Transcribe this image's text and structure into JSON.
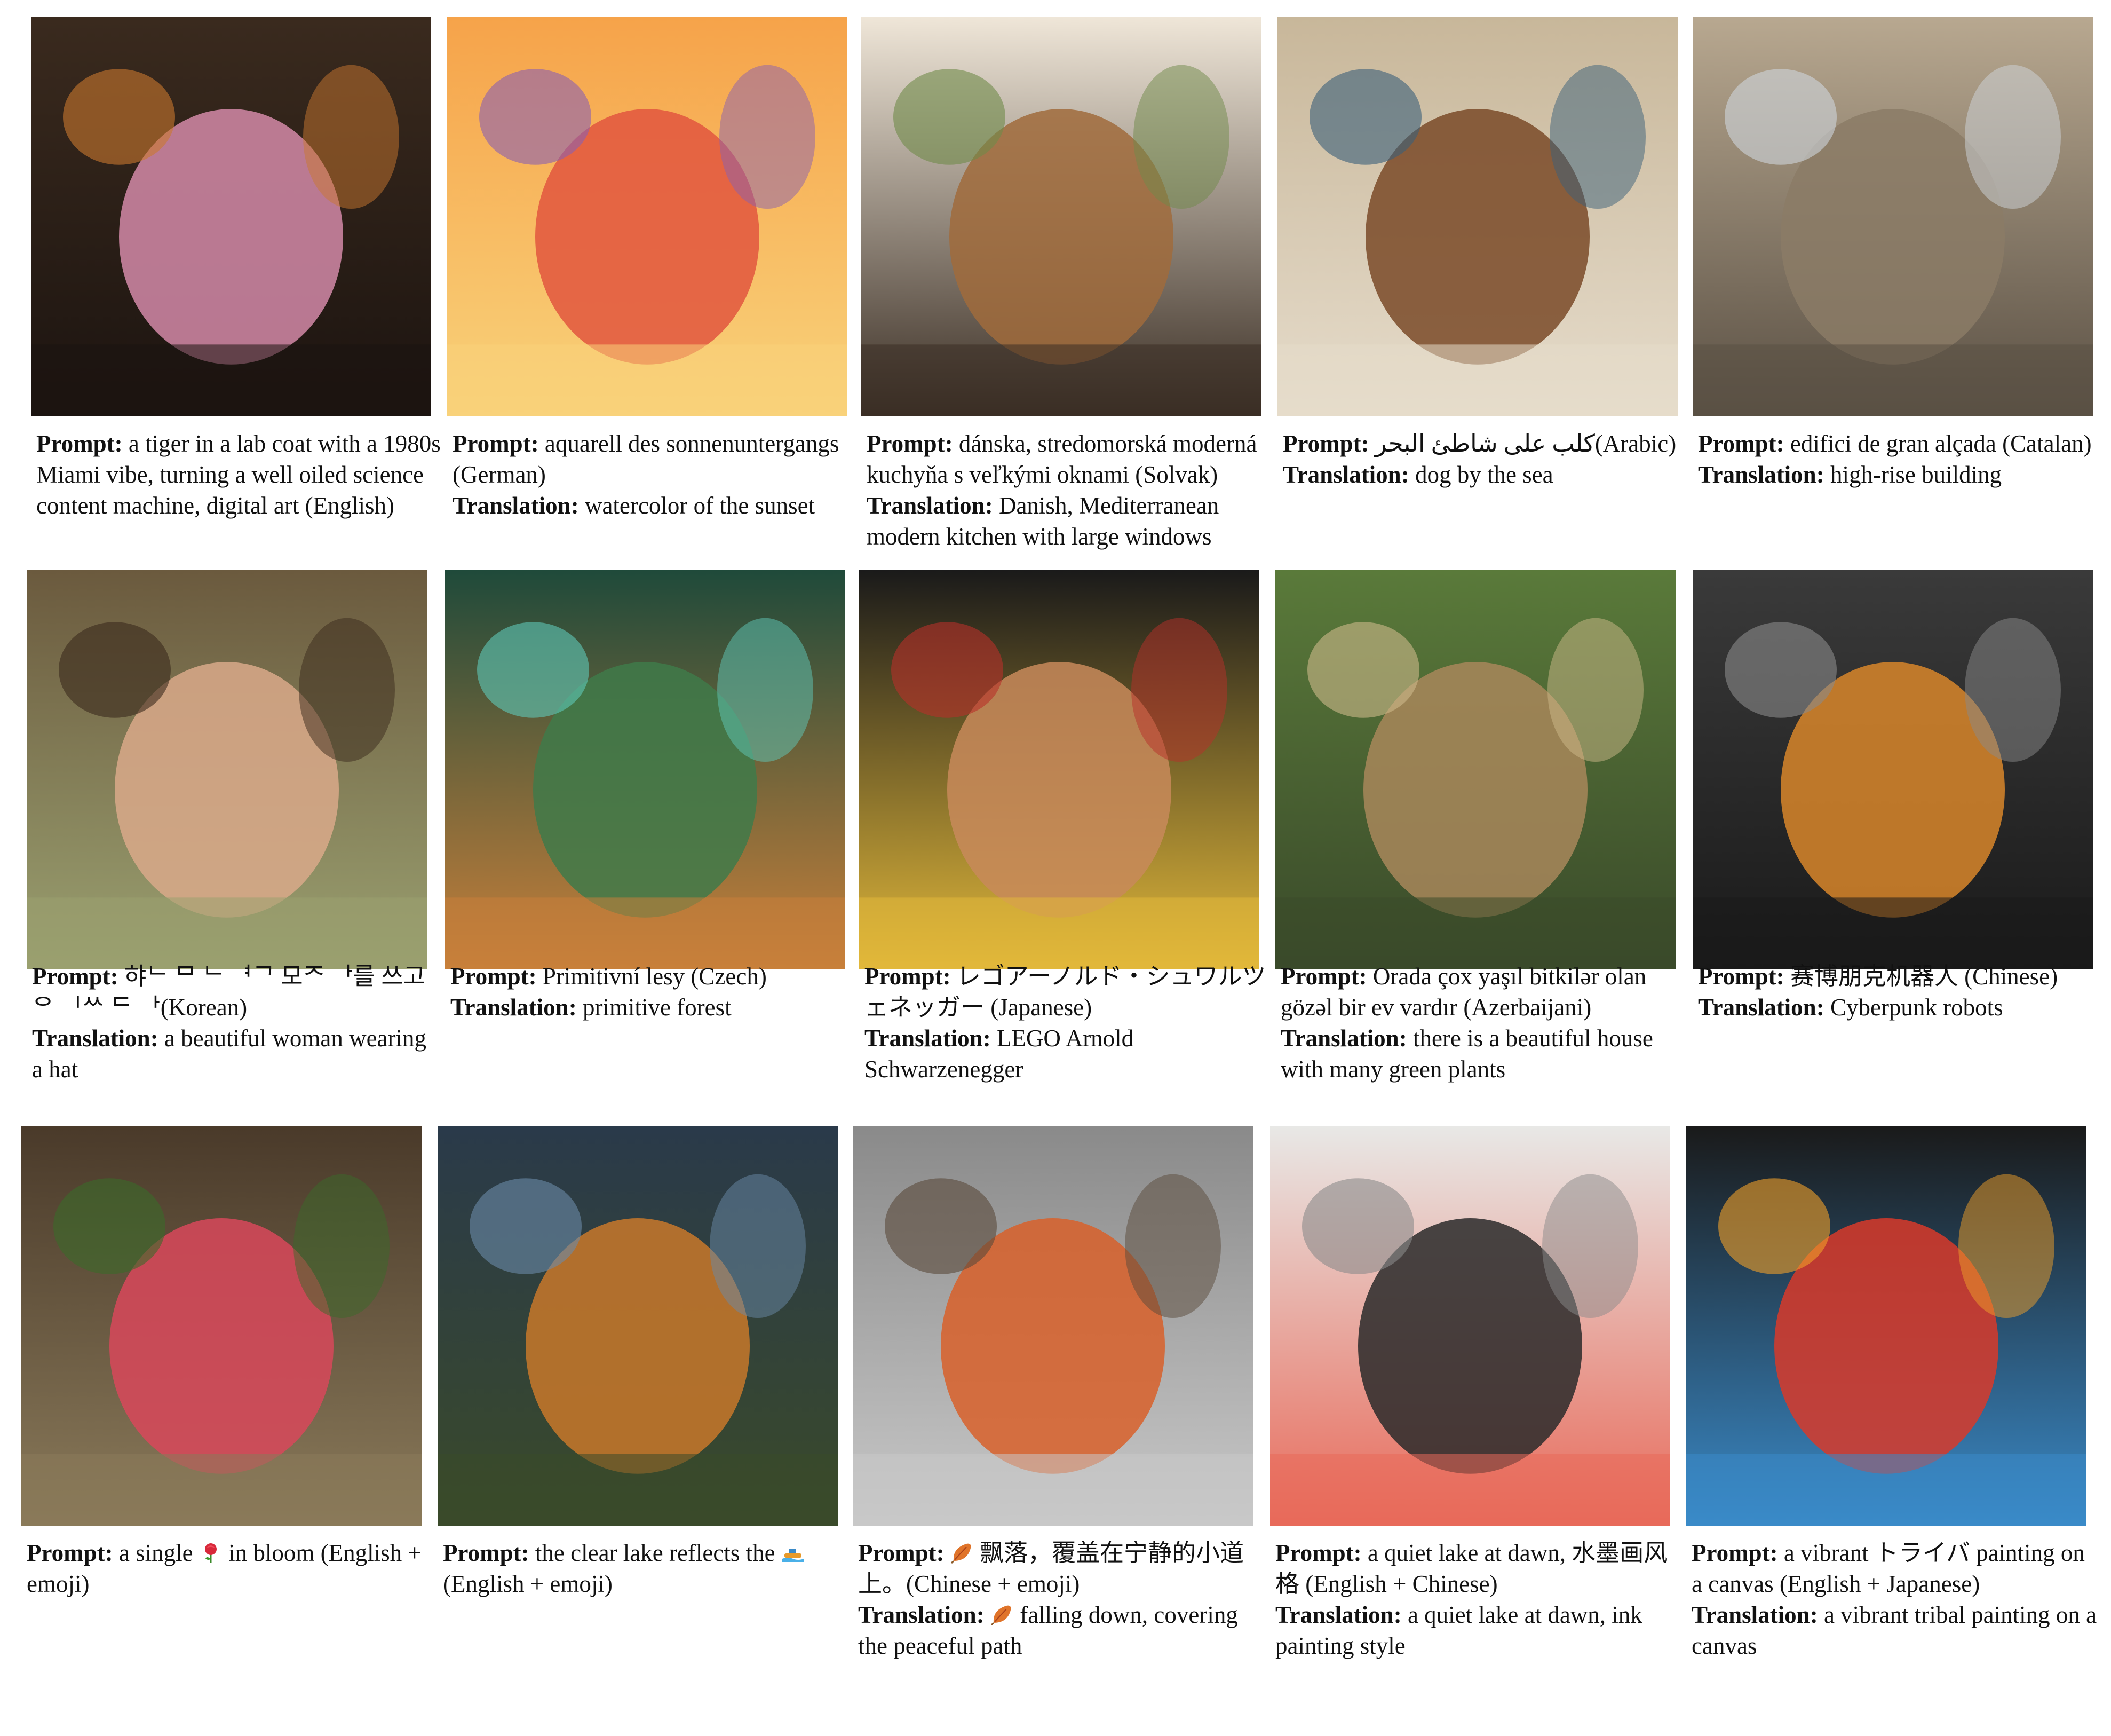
{
  "prompt_label": "Prompt:",
  "translation_label": "Translation:",
  "items": [
    {
      "prompt": "a tiger in a lab coat with a 1980s Miami vibe, turning a well oiled science content machine, digital art (English)",
      "translation": "",
      "image": "tiger-in-lab-coat-image",
      "palette": [
        "#3a2a1e",
        "#d48aa8",
        "#c9782f",
        "#1c1410"
      ]
    },
    {
      "prompt": "aquarell des sonnenuntergangs (German)",
      "translation": "watercolor of the sunset",
      "image": "watercolor-sunset-image",
      "palette": [
        "#f6a34a",
        "#e2563e",
        "#8a5fb0",
        "#f9d27a"
      ]
    },
    {
      "prompt": "dánska, stredomorská moderná kuchyňa s veľkými oknami (Solvak)",
      "translation": "Danish, Mediterranean modern kitchen with large windows",
      "image": "kitchen-image",
      "palette": [
        "#efe6d8",
        "#a06b3c",
        "#6f8a4a",
        "#3a2e24"
      ]
    },
    {
      "prompt": "كلب على شاطئ البحر(Arabic)",
      "translation": "dog by the sea",
      "image": "dog-on-beach-image",
      "palette": [
        "#c8b79a",
        "#7a4a28",
        "#3a5f7a",
        "#e6dccb"
      ]
    },
    {
      "prompt": "edifici de gran alçada (Catalan)",
      "translation": "high-rise building",
      "image": "high-rise-building-image",
      "palette": [
        "#b8a890",
        "#8b7b66",
        "#cfd6dc",
        "#5a5044"
      ]
    },
    {
      "prompt": "햐ᄂ ᄆ ᄂ ᅧᄀ 모ᄌ ᅡ를 쓰고 ᄋ ᅵᄊ ᄃ ᅡ(Korean)",
      "translation": "a beautiful woman wearing a hat",
      "image": "woman-in-hat-image",
      "palette": [
        "#6b5a3e",
        "#d9a98a",
        "#3a2a1c",
        "#9aa070"
      ]
    },
    {
      "prompt": "Primitivní lesy (Czech)",
      "translation": "primitive forest",
      "image": "primitive-forest-image",
      "palette": [
        "#1f4a3a",
        "#3f7a4a",
        "#5fc8b8",
        "#c8803a"
      ]
    },
    {
      "prompt": "レゴアーノルド・シュワルツェネッガー (Japanese)",
      "translation": "LEGO Arnold Schwarzenegger",
      "image": "lego-figure-image",
      "palette": [
        "#1a1a1a",
        "#c88a5a",
        "#b8302a",
        "#e2b83a"
      ]
    },
    {
      "prompt": "Orada çox yaşıl bitkilər olan gözəl bir ev vardır (Azerbaijani)",
      "translation": "there is a beautiful house with many green plants",
      "image": "house-with-plants-image",
      "palette": [
        "#5a7a3a",
        "#a8875a",
        "#cdb98a",
        "#3a4a2a"
      ]
    },
    {
      "prompt": "赛博朋克机器人 (Chinese)",
      "translation": "Cyberpunk robots",
      "image": "cyberpunk-robot-image",
      "palette": [
        "#3a3a3a",
        "#d8862a",
        "#8a8a8a",
        "#1a1a1a"
      ]
    },
    {
      "prompt_before": "a single",
      "prompt_after": "in bloom (English + emoji)",
      "emoji": "rose-emoji",
      "translation": "",
      "image": "rose-image",
      "palette": [
        "#4a3a2a",
        "#d8485a",
        "#3a6a2a",
        "#8a7a5a"
      ]
    },
    {
      "prompt_before": "the clear lake reflects the",
      "prompt_after": "(English + emoji)",
      "emoji": "boat-emoji",
      "translation": "",
      "image": "lake-boat-image",
      "palette": [
        "#2a3a4a",
        "#c8782a",
        "#6a8aa8",
        "#3a4a2a"
      ]
    },
    {
      "prompt_before": "",
      "prompt_after": "飘落，覆盖在宁静的小道上。(Chinese + emoji)",
      "emoji": "leaf-emoji",
      "translation_before": "",
      "translation_after": "falling down, covering the peaceful path",
      "translation_emoji": "leaf-emoji",
      "image": "autumn-path-image",
      "palette": [
        "#8a8a8a",
        "#d8602a",
        "#5a4a3a",
        "#c8c8c8"
      ]
    },
    {
      "prompt": "a quiet lake at dawn, 水墨画风格 (English + Chinese)",
      "translation": "a quiet lake at dawn, ink painting style",
      "image": "ink-lake-image",
      "palette": [
        "#e8e8e6",
        "#2a2a2a",
        "#8a8a8a",
        "#e86a5a"
      ]
    },
    {
      "prompt": "a vibrant トライバ painting on a canvas (English + Japanese)",
      "translation": "a vibrant tribal painting on a canvas",
      "image": "tribal-painting-image",
      "palette": [
        "#1a1a1a",
        "#d83a2a",
        "#f0a02a",
        "#3a8ac8"
      ]
    }
  ]
}
